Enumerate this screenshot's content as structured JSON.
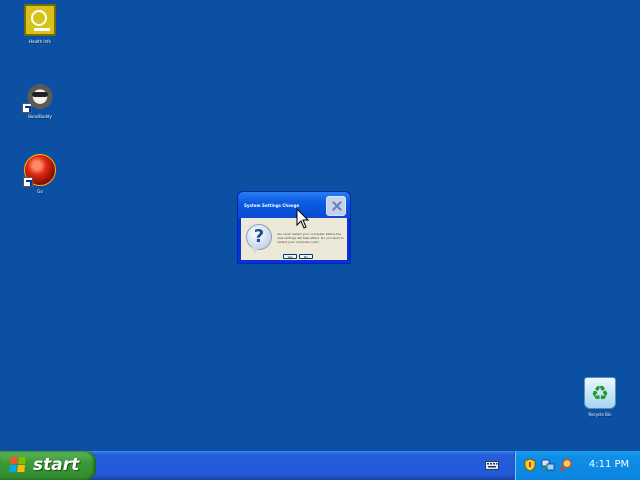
{
  "desktop": {
    "icons": [
      {
        "label": "Health Info",
        "type": "health"
      },
      {
        "label": "BonziBuddy",
        "type": "raccoon"
      },
      {
        "label": "Go",
        "type": "red-button"
      },
      {
        "label": "Recycle Bin",
        "type": "recycle-bin"
      }
    ]
  },
  "dialog": {
    "title": "System Settings Change",
    "icon": "question-icon",
    "message": "You must restart your computer before the new settings will take effect. Do you want to restart your computer now?",
    "buttons": {
      "yes": "Yes",
      "no": "No"
    }
  },
  "taskbar": {
    "start_label": "start",
    "tray_icons": [
      "keyboard-icon",
      "security-shield-icon",
      "network-icon",
      "search-icon"
    ],
    "clock": "4:11 PM"
  },
  "colors": {
    "desktop": "#0b50a3",
    "taskbar": "#245edb",
    "start_button": "#3c9a37",
    "tray": "#0f8ee8",
    "dialog_title": "#0a5ce3",
    "dialog_body": "#ece9d8"
  }
}
